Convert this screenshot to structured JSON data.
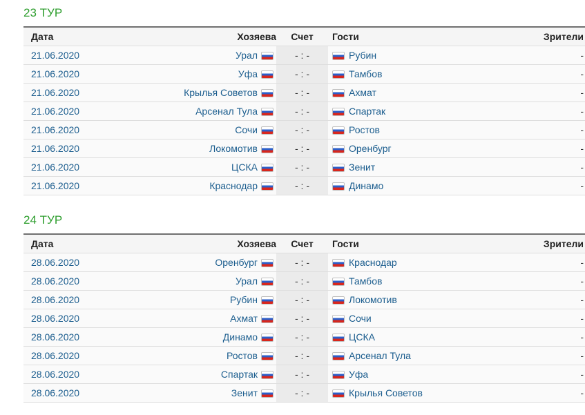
{
  "columns": {
    "date": "Дата",
    "home": "Хозяева",
    "score": "Счет",
    "away": "Гости",
    "spectators": "Зрители"
  },
  "flag_icon": "russia-flag-icon",
  "link_color": "#1b5d8e",
  "title_color": "#2e9e2e",
  "rounds": [
    {
      "title": "23 ТУР",
      "matches": [
        {
          "date": "21.06.2020",
          "home": "Урал",
          "score": "- : -",
          "away": "Рубин",
          "spectators": "-"
        },
        {
          "date": "21.06.2020",
          "home": "Уфа",
          "score": "- : -",
          "away": "Тамбов",
          "spectators": "-"
        },
        {
          "date": "21.06.2020",
          "home": "Крылья Советов",
          "score": "- : -",
          "away": "Ахмат",
          "spectators": "-"
        },
        {
          "date": "21.06.2020",
          "home": "Арсенал Тула",
          "score": "- : -",
          "away": "Спартак",
          "spectators": "-"
        },
        {
          "date": "21.06.2020",
          "home": "Сочи",
          "score": "- : -",
          "away": "Ростов",
          "spectators": "-"
        },
        {
          "date": "21.06.2020",
          "home": "Локомотив",
          "score": "- : -",
          "away": "Оренбург",
          "spectators": "-"
        },
        {
          "date": "21.06.2020",
          "home": "ЦСКА",
          "score": "- : -",
          "away": "Зенит",
          "spectators": "-"
        },
        {
          "date": "21.06.2020",
          "home": "Краснодар",
          "score": "- : -",
          "away": "Динамо",
          "spectators": "-"
        }
      ]
    },
    {
      "title": "24 ТУР",
      "matches": [
        {
          "date": "28.06.2020",
          "home": "Оренбург",
          "score": "- : -",
          "away": "Краснодар",
          "spectators": "-"
        },
        {
          "date": "28.06.2020",
          "home": "Урал",
          "score": "- : -",
          "away": "Тамбов",
          "spectators": "-"
        },
        {
          "date": "28.06.2020",
          "home": "Рубин",
          "score": "- : -",
          "away": "Локомотив",
          "spectators": "-"
        },
        {
          "date": "28.06.2020",
          "home": "Ахмат",
          "score": "- : -",
          "away": "Сочи",
          "spectators": "-"
        },
        {
          "date": "28.06.2020",
          "home": "Динамо",
          "score": "- : -",
          "away": "ЦСКА",
          "spectators": "-"
        },
        {
          "date": "28.06.2020",
          "home": "Ростов",
          "score": "- : -",
          "away": "Арсенал Тула",
          "spectators": "-"
        },
        {
          "date": "28.06.2020",
          "home": "Спартак",
          "score": "- : -",
          "away": "Уфа",
          "spectators": "-"
        },
        {
          "date": "28.06.2020",
          "home": "Зенит",
          "score": "- : -",
          "away": "Крылья Советов",
          "spectators": "-"
        }
      ]
    }
  ]
}
